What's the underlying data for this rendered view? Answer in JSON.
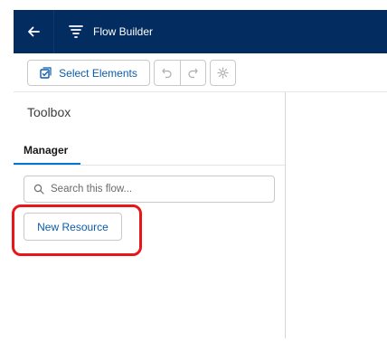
{
  "header": {
    "app_title": "Flow Builder",
    "background_color": "#032d60",
    "back_icon": "arrow-left-icon",
    "app_icon": "flow-icon"
  },
  "toolbar": {
    "select_elements_label": "Select Elements",
    "select_icon": "select-elements-icon",
    "undo_icon": "undo-icon",
    "redo_icon": "redo-icon",
    "settings_icon": "gear-icon"
  },
  "toolbox": {
    "title": "Toolbox",
    "tabs": [
      {
        "label": "Manager",
        "active": true
      }
    ],
    "search": {
      "placeholder": "Search this flow...",
      "value": ""
    },
    "new_resource_label": "New Resource"
  },
  "colors": {
    "accent": "#0176d3",
    "link": "#0b5cab",
    "highlight": "#e8151b"
  }
}
